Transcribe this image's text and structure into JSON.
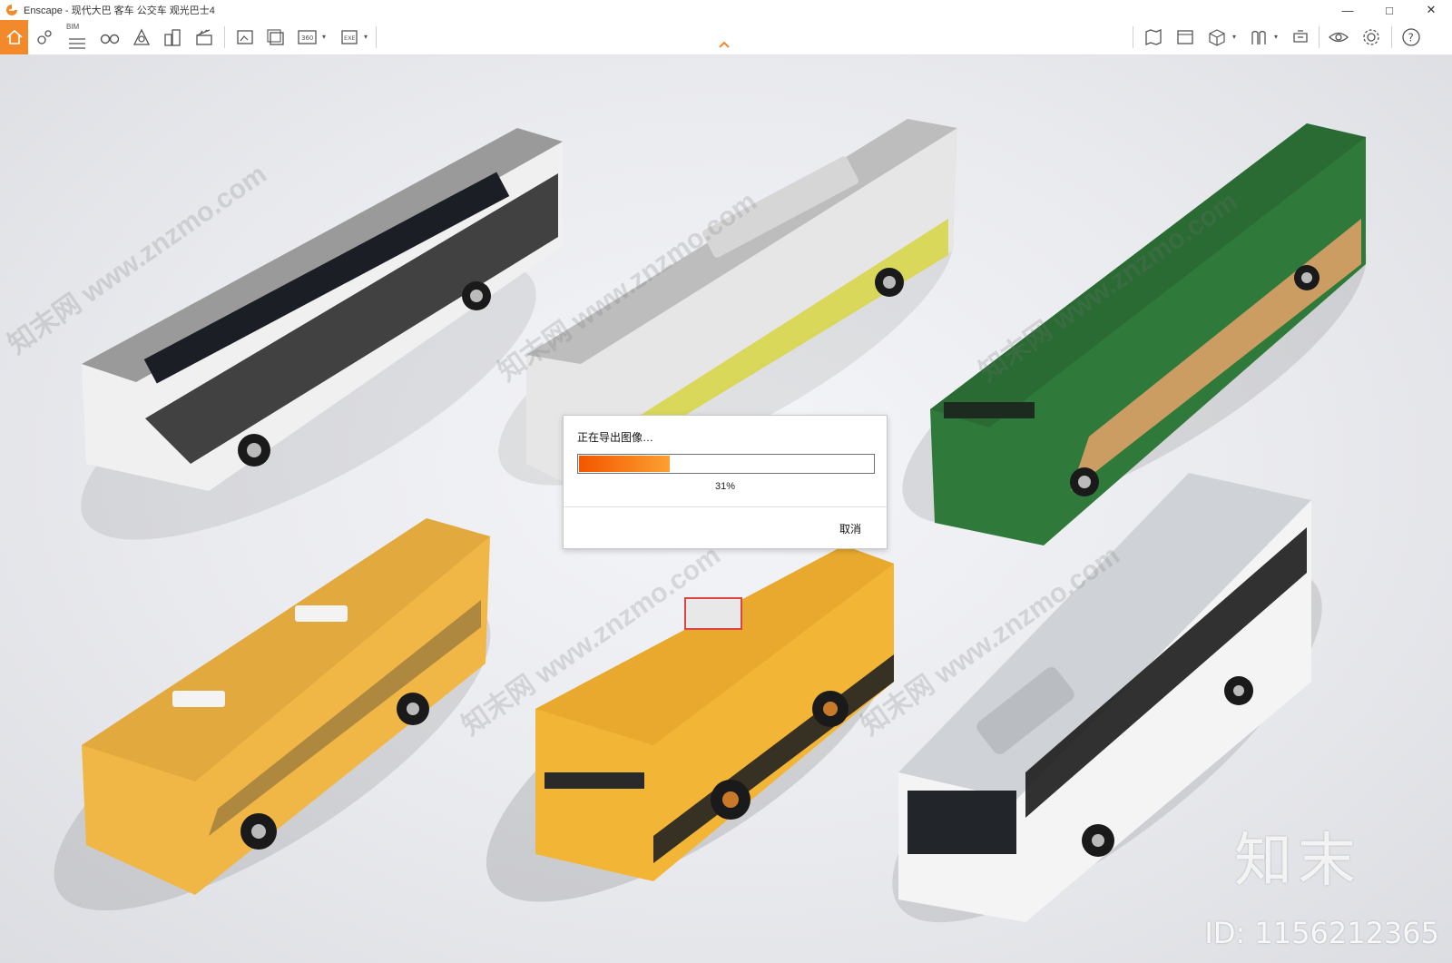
{
  "window": {
    "title": "Enscape - 现代大巴 客车 公交车 观光巴士4",
    "controls": [
      "minimize-icon",
      "maximize-icon",
      "close-icon"
    ]
  },
  "toolbar": {
    "bim_label": "BIM",
    "accent_color": "#f28a2c",
    "left_icons": [
      "home-icon",
      "location-icon",
      "bim-list-icon",
      "binoculars-icon",
      "sun-view-icon",
      "buildings-icon",
      "clapperboard-icon",
      "screenshot-icon",
      "batch-render-icon",
      "panorama-360-icon",
      "exe-export-icon"
    ],
    "right_icons": [
      "map-icon",
      "image-gallery-icon",
      "cube-icon",
      "asset-library-icon",
      "capture-icon",
      "visual-settings-icon",
      "gear-icon",
      "help-icon"
    ]
  },
  "viewport": {
    "watermark_text": "知末网 www.znzmo.com",
    "watermark_logo": "知末",
    "watermark_id": "ID: 1156212365"
  },
  "buses": [
    {
      "name": "electric-bus",
      "body": "#f0f0f0",
      "roof": "#9a9a9a",
      "band": "#222222"
    },
    {
      "name": "hybrid-bus",
      "body": "#e6e6e6",
      "roof": "#bdbdbd",
      "band": "#d8d64a"
    },
    {
      "name": "articulated-green-bus",
      "body": "#2f7a3a",
      "roof": "#2a6a33",
      "band": "#e7a36b"
    },
    {
      "name": "yellow-city-bus",
      "body": "#f0b646",
      "roof": "#e2a93e",
      "band": "#333333"
    },
    {
      "name": "school-bus",
      "body": "#f2b536",
      "roof": "#e8a92e",
      "band": "#222222"
    },
    {
      "name": "white-city-bus",
      "body": "#f4f4f4",
      "roof": "#cfd2d6",
      "band": "#1c1c1c"
    }
  ],
  "dialog": {
    "title": "正在导出图像…",
    "progress": 0.31,
    "percent_text": "31%",
    "cancel_label": "取消"
  }
}
